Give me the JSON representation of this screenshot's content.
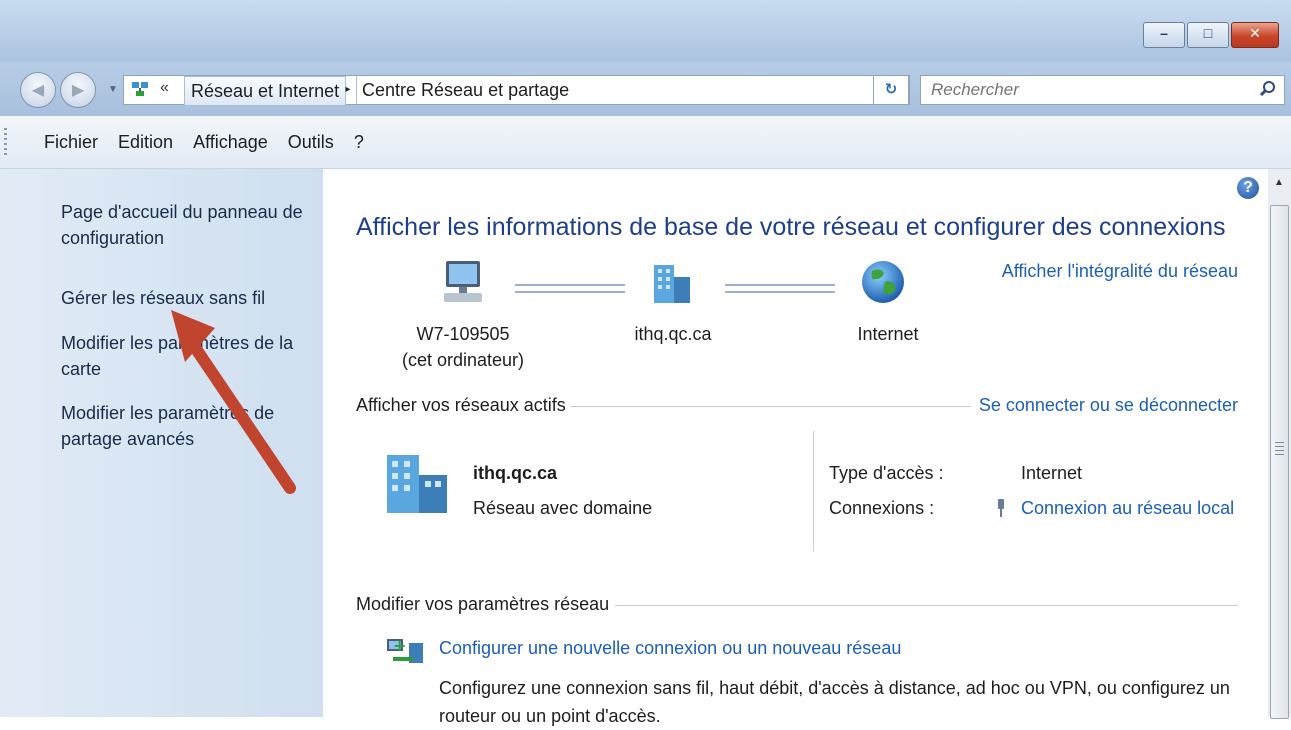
{
  "window": {
    "minimize_glyph": "–",
    "maximize_glyph": "□",
    "close_glyph": "✕"
  },
  "address": {
    "chevron": "«",
    "crumb_parent": "Réseau et Internet",
    "crumb_separator": "▸",
    "crumb_current": "Centre Réseau et partage",
    "dropdown_glyph": "▾",
    "refresh_glyph": "↻"
  },
  "search": {
    "placeholder": "Rechercher"
  },
  "menu": {
    "items": [
      "Fichier",
      "Edition",
      "Affichage",
      "Outils",
      "?"
    ]
  },
  "sidebar": {
    "links": [
      "Page d'accueil du panneau de configuration",
      "Gérer les réseaux sans fil",
      "Modifier les paramètres de la carte",
      "Modifier les paramètres de partage avancés"
    ]
  },
  "main": {
    "help_glyph": "?",
    "heading": "Afficher les informations de base de votre réseau et configurer des connexions",
    "see_full_map": "Afficher l'intégralité du réseau",
    "nodes": {
      "computer": "W7-109505",
      "computer_sub": "(cet ordinateur)",
      "domain": "ithq.qc.ca",
      "internet": "Internet"
    },
    "active_networks": {
      "title": "Afficher vos réseaux actifs",
      "connect_link": "Se connecter ou se déconnecter",
      "network_name": "ithq.qc.ca",
      "network_category": "Réseau avec domaine",
      "access_type_label": "Type d'accès :",
      "access_type_value": "Internet",
      "connections_label": "Connexions :",
      "connections_value": "Connexion au réseau local"
    },
    "change_settings": {
      "title": "Modifier vos paramètres réseau",
      "new_connection_link": "Configurer une nouvelle connexion ou un nouveau réseau",
      "new_connection_desc": "Configurez une connexion sans fil, haut débit, d'accès à distance, ad hoc ou VPN, ou configurez un routeur ou un point d'accès."
    }
  },
  "colors": {
    "accent": "#1c5fb5",
    "arrow": "#c1442e"
  }
}
